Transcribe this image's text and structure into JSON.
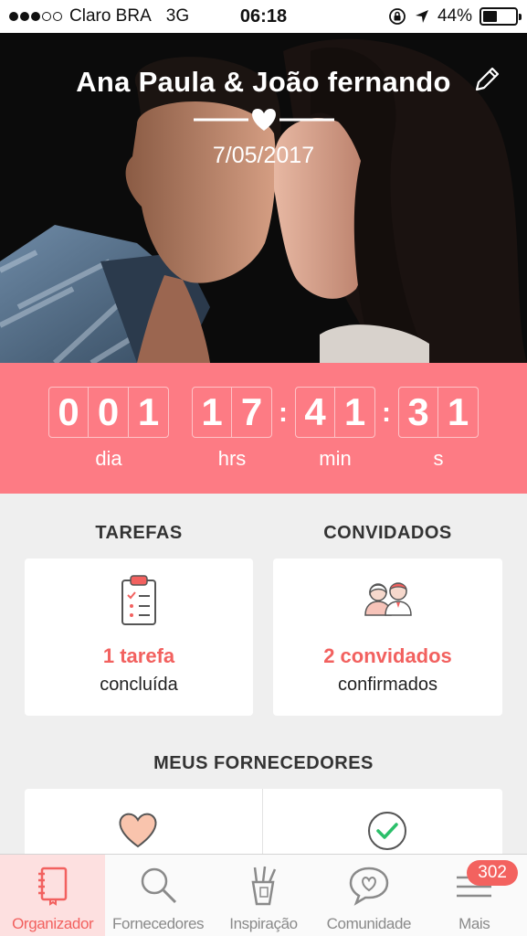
{
  "status_bar": {
    "carrier": "Claro BRA",
    "network": "3G",
    "time": "06:18",
    "battery": "44%",
    "battery_level": 0.44,
    "signal_bars_filled": 3,
    "signal_bars_total": 5
  },
  "hero": {
    "couple_names": "Ana Paula & João fernando",
    "wedding_date": "7/05/2017"
  },
  "countdown": {
    "days": [
      "0",
      "0",
      "1"
    ],
    "hours": [
      "1",
      "7"
    ],
    "minutes": [
      "4",
      "1"
    ],
    "seconds": [
      "3",
      "1"
    ],
    "days_label": "dia",
    "hours_label": "hrs",
    "minutes_label": "min",
    "seconds_label": "s"
  },
  "tasks": {
    "title": "TAREFAS",
    "value": "1 tarefa",
    "subtitle": "concluída"
  },
  "guests": {
    "title": "CONVIDADOS",
    "value": "2 convidados",
    "subtitle": "confirmados"
  },
  "vendors": {
    "title": "MEUS FORNECEDORES"
  },
  "colors": {
    "accent": "#fd7b84",
    "accent_text": "#f2615f",
    "background": "#efefef"
  },
  "tab_bar": {
    "items": [
      {
        "label": "Organizador",
        "icon": "notebook-icon",
        "active": true
      },
      {
        "label": "Fornecedores",
        "icon": "search-icon",
        "active": false
      },
      {
        "label": "Inspiração",
        "icon": "pencil-cup-icon",
        "active": false
      },
      {
        "label": "Comunidade",
        "icon": "chat-heart-icon",
        "active": false
      },
      {
        "label": "Mais",
        "icon": "menu-icon",
        "active": false
      }
    ],
    "mais_badge": "302"
  }
}
